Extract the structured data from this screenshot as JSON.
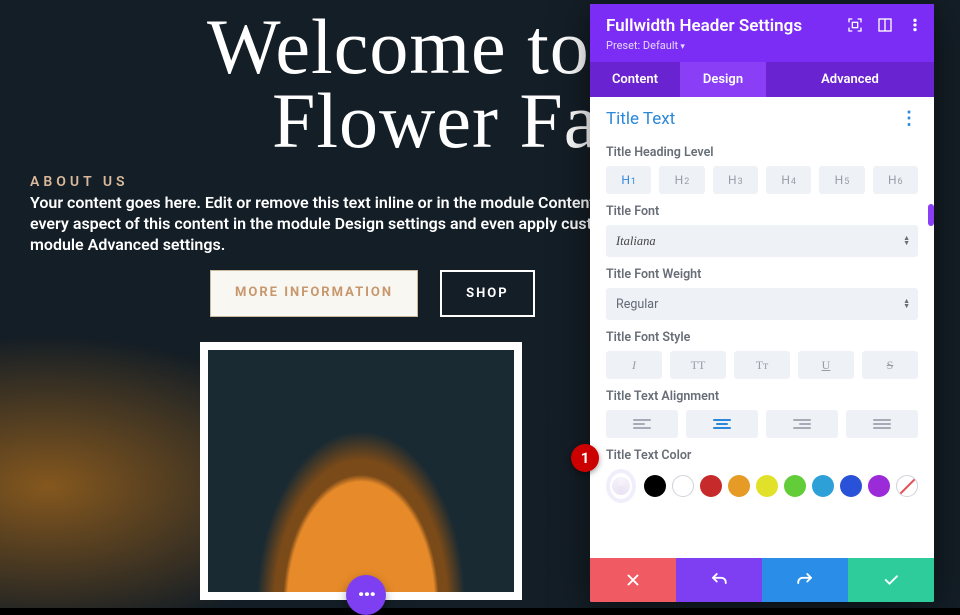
{
  "page": {
    "hero_title_line1": "Welcome to Divi",
    "hero_title_line2": "Flower Farm",
    "about_label": "ABOUT US",
    "about_text": "Your content goes here. Edit or remove this text inline or in the module Content settings. You can also style every aspect of this content in the module Design settings and even apply custom CSS to this text in the module Advanced settings.",
    "btn_more": "MORE INFORMATION",
    "btn_shop": "SHOP"
  },
  "marker": {
    "num": "1"
  },
  "panel": {
    "title": "Fullwidth Header Settings",
    "preset": "Preset: Default",
    "tabs": {
      "content": "Content",
      "design": "Design",
      "advanced": "Advanced"
    },
    "section": "Title Text",
    "labels": {
      "heading": "Title Heading Level",
      "font": "Title Font",
      "weight": "Title Font Weight",
      "style": "Title Font Style",
      "align": "Title Text Alignment",
      "color": "Title Text Color"
    },
    "headings": [
      {
        "h": "H",
        "n": "1",
        "active": true
      },
      {
        "h": "H",
        "n": "2",
        "active": false
      },
      {
        "h": "H",
        "n": "3",
        "active": false
      },
      {
        "h": "H",
        "n": "4",
        "active": false
      },
      {
        "h": "H",
        "n": "5",
        "active": false
      },
      {
        "h": "H",
        "n": "6",
        "active": false
      }
    ],
    "font_value": "Italiana",
    "weight_value": "Regular",
    "styles": {
      "italic": "I",
      "upper": "TT",
      "smallcaps": "Tᴛ",
      "underline": "U",
      "strike": "S"
    },
    "colors": [
      {
        "type": "selected"
      },
      {
        "type": "solid",
        "hex": "#000000"
      },
      {
        "type": "white"
      },
      {
        "type": "solid",
        "hex": "#c62a2a"
      },
      {
        "type": "solid",
        "hex": "#e59b25"
      },
      {
        "type": "solid",
        "hex": "#e1e12a"
      },
      {
        "type": "solid",
        "hex": "#63cc39"
      },
      {
        "type": "solid",
        "hex": "#2ea0d8"
      },
      {
        "type": "solid",
        "hex": "#2a52d8"
      },
      {
        "type": "solid",
        "hex": "#9b2ad8"
      },
      {
        "type": "none"
      }
    ]
  }
}
